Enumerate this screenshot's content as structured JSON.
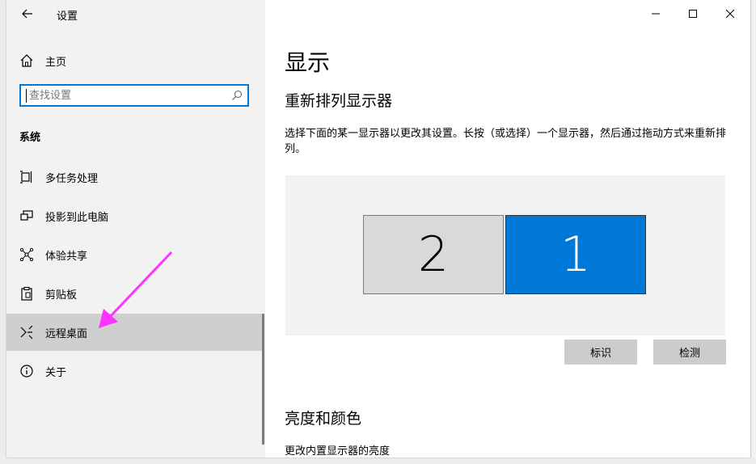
{
  "window": {
    "title": "设置"
  },
  "sidebar": {
    "home_label": "主页",
    "search_placeholder": "查找设置",
    "section_label": "系统",
    "items": [
      {
        "label": "多任务处理",
        "icon": "multitasking-icon"
      },
      {
        "label": "投影到此电脑",
        "icon": "projecting-icon"
      },
      {
        "label": "体验共享",
        "icon": "shared-experiences-icon"
      },
      {
        "label": "剪贴板",
        "icon": "clipboard-icon"
      },
      {
        "label": "远程桌面",
        "icon": "remote-desktop-icon",
        "selected": true
      },
      {
        "label": "关于",
        "icon": "info-icon"
      }
    ]
  },
  "main": {
    "title": "显示",
    "arrange_heading": "重新排列显示器",
    "arrange_desc": "选择下面的某一显示器以更改其设置。长按（或选择）一个显示器，然后通过拖动方式来重新排列。",
    "monitors": [
      {
        "number": "2",
        "selected": false
      },
      {
        "number": "1",
        "selected": true
      }
    ],
    "identify_button": "标识",
    "detect_button": "检测",
    "brightness_heading": "亮度和颜色",
    "brightness_sub": "更改内置显示器的亮度"
  },
  "colors": {
    "accent": "#0078d7",
    "annotation_arrow": "#ff33ff"
  }
}
